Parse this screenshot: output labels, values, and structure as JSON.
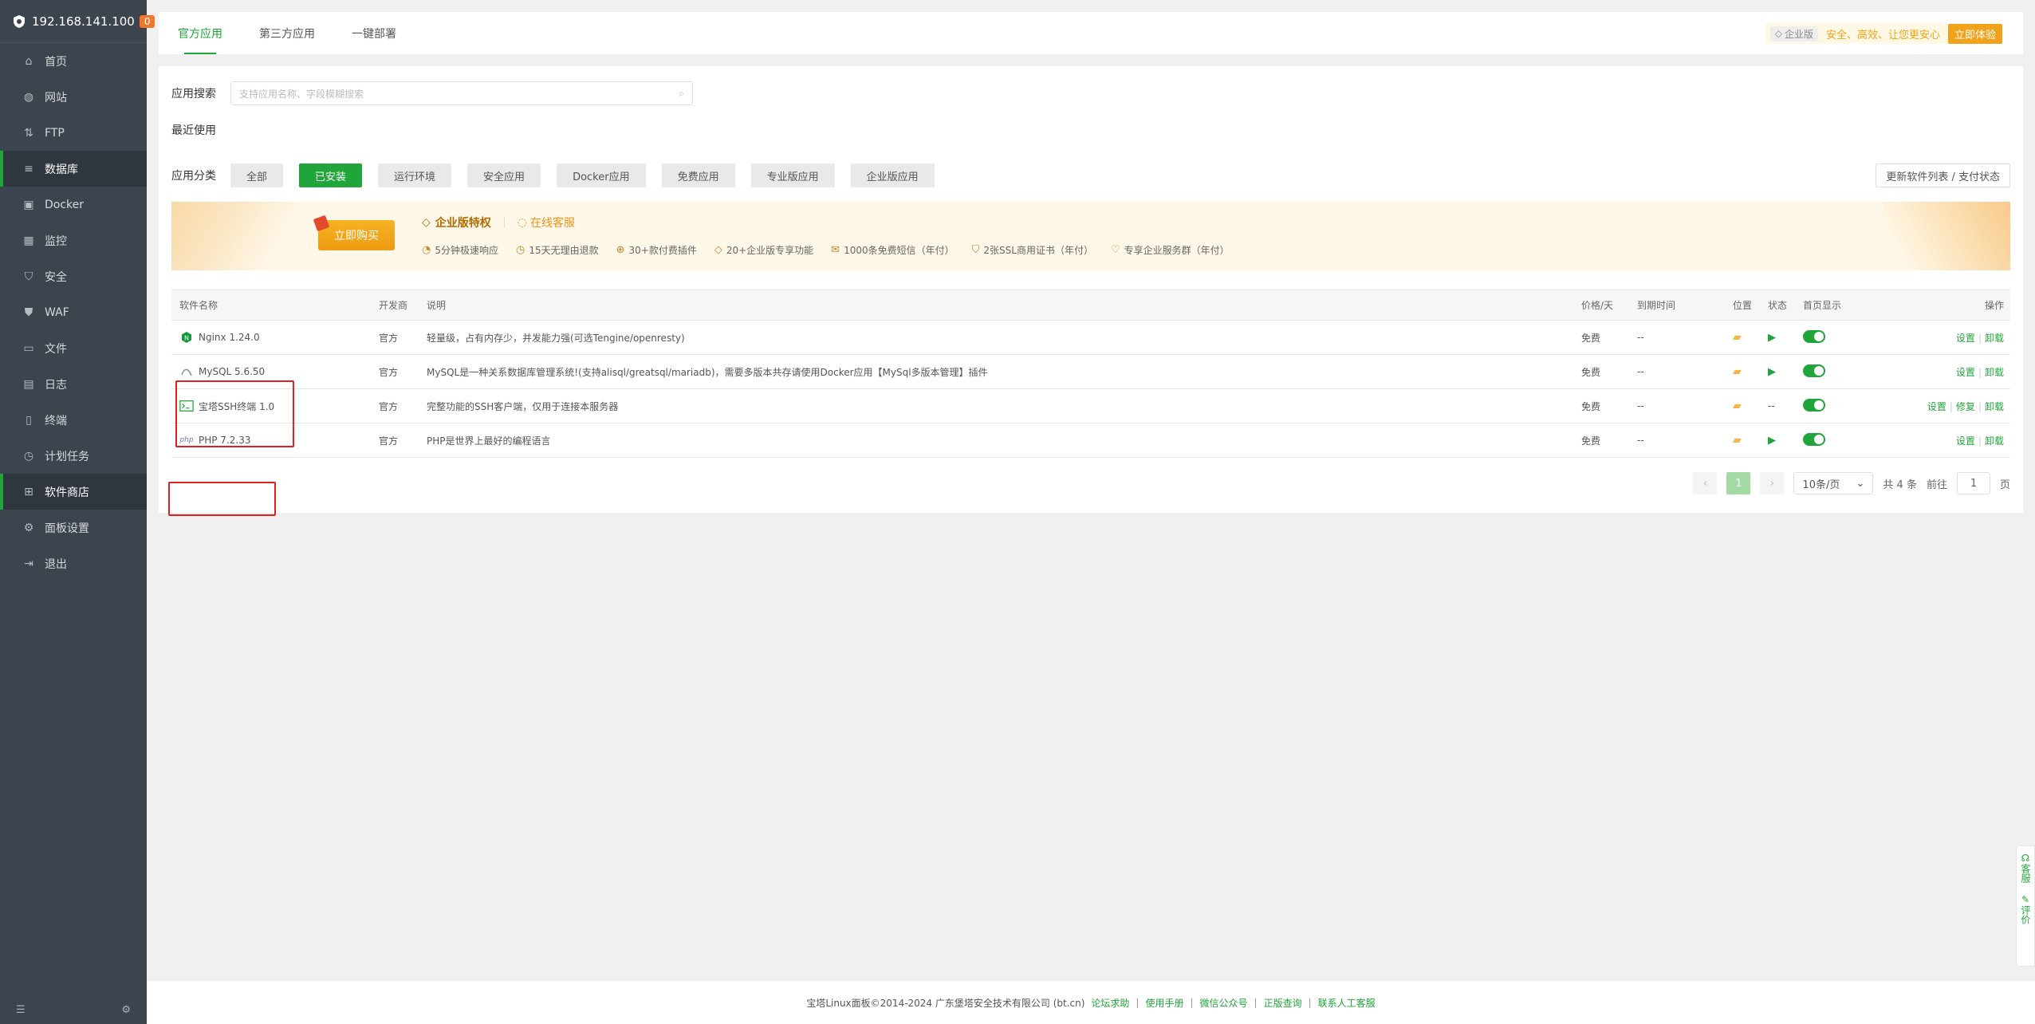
{
  "sidebar": {
    "ip": "192.168.141.100",
    "badge": "0",
    "items": [
      {
        "label": "首页",
        "icon": "home-icon"
      },
      {
        "label": "网站",
        "icon": "globe-icon"
      },
      {
        "label": "FTP",
        "icon": "ftp-icon"
      },
      {
        "label": "数据库",
        "icon": "database-icon"
      },
      {
        "label": "Docker",
        "icon": "docker-icon"
      },
      {
        "label": "监控",
        "icon": "monitor-icon"
      },
      {
        "label": "安全",
        "icon": "shield-icon"
      },
      {
        "label": "WAF",
        "icon": "waf-icon"
      },
      {
        "label": "文件",
        "icon": "folder-icon"
      },
      {
        "label": "日志",
        "icon": "log-icon"
      },
      {
        "label": "终端",
        "icon": "terminal-icon"
      },
      {
        "label": "计划任务",
        "icon": "clock-icon"
      },
      {
        "label": "软件商店",
        "icon": "grid-icon"
      },
      {
        "label": "面板设置",
        "icon": "gear-icon"
      },
      {
        "label": "退出",
        "icon": "logout-icon"
      }
    ]
  },
  "tabs": [
    "官方应用",
    "第三方应用",
    "一键部署"
  ],
  "promo": {
    "tag": "企业版",
    "text": "安全、高效、让您更安心",
    "button": "立即体验"
  },
  "search": {
    "label": "应用搜索",
    "placeholder": "支持应用名称、字段模糊搜索"
  },
  "recent_label": "最近使用",
  "category": {
    "label": "应用分类",
    "items": [
      "全部",
      "已安装",
      "运行环境",
      "安全应用",
      "Docker应用",
      "免费应用",
      "专业版应用",
      "企业版应用"
    ],
    "update_button": "更新软件列表 / 支付状态"
  },
  "banner": {
    "buy": "立即购买",
    "title": "企业版特权",
    "service": "在线客服",
    "features": [
      "5分钟极速响应",
      "15天无理由退款",
      "30+款付费插件",
      "20+企业版专享功能",
      "1000条免费短信（年付）",
      "2张SSL商用证书（年付）",
      "专享企业服务群（年付）"
    ]
  },
  "table": {
    "headers": [
      "软件名称",
      "开发商",
      "说明",
      "价格/天",
      "到期时间",
      "位置",
      "状态",
      "首页显示",
      "操作"
    ],
    "rows": [
      {
        "name": "Nginx 1.24.0",
        "dev": "官方",
        "desc": "轻量级，占有内存少，并发能力强(可选Tengine/openresty)",
        "price": "免费",
        "expire": "--",
        "status": "▶",
        "ops": [
          "设置",
          "卸载"
        ]
      },
      {
        "name": "MySQL 5.6.50",
        "dev": "官方",
        "desc": "MySQL是一种关系数据库管理系统!(支持alisql/greatsql/mariadb)，需要多版本共存请使用Docker应用【MySql多版本管理】插件",
        "price": "免费",
        "expire": "--",
        "status": "▶",
        "ops": [
          "设置",
          "卸载"
        ]
      },
      {
        "name": "宝塔SSH终端 1.0",
        "dev": "官方",
        "desc": "完整功能的SSH客户端，仅用于连接本服务器",
        "price": "免费",
        "expire": "--",
        "status": "--",
        "ops": [
          "设置",
          "修复",
          "卸载"
        ]
      },
      {
        "name": "PHP 7.2.33",
        "dev": "官方",
        "desc": "PHP是世界上最好的编程语言",
        "price": "免费",
        "expire": "--",
        "status": "▶",
        "ops": [
          "设置",
          "卸载"
        ]
      }
    ]
  },
  "pager": {
    "page": "1",
    "size": "10条/页",
    "total": "共 4 条",
    "goto": "前往",
    "goto_val": "1",
    "unit": "页"
  },
  "footer": {
    "copyright": "宝塔Linux面板©2014-2024 广东堡塔安全技术有限公司 (bt.cn)",
    "links": [
      "论坛求助",
      "使用手册",
      "微信公众号",
      "正版查询",
      "联系人工客服"
    ]
  },
  "float": {
    "service": "客服",
    "review": "评价"
  }
}
